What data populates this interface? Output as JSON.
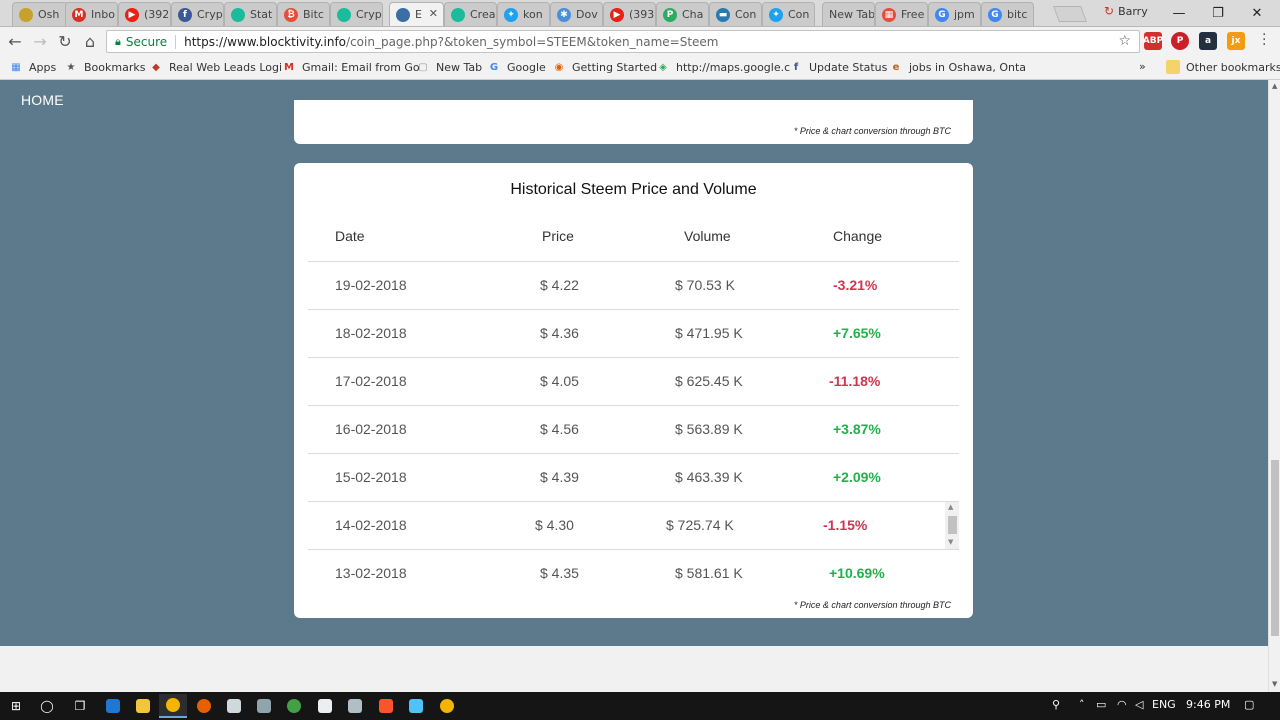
{
  "browser": {
    "tabs": [
      {
        "title": "Osh",
        "color": "#c6a12b",
        "glyph": ""
      },
      {
        "title": "Inbo",
        "color": "#d93025",
        "glyph": "M"
      },
      {
        "title": "(392",
        "color": "#e62117",
        "glyph": "▶"
      },
      {
        "title": "Cryp",
        "color": "#3b5998",
        "glyph": "f"
      },
      {
        "title": "Stat",
        "color": "#1abc9c",
        "glyph": ""
      },
      {
        "title": "Bitc",
        "color": "#e74c3c",
        "glyph": "₿"
      },
      {
        "title": "Cryp",
        "color": "#1abc9c",
        "glyph": ""
      },
      {
        "title": "E",
        "color": "#3a6ea5",
        "glyph": "",
        "active": true
      },
      {
        "title": "Crea",
        "color": "#1abc9c",
        "glyph": ""
      },
      {
        "title": "kon",
        "color": "#1da1f2",
        "glyph": "✦"
      },
      {
        "title": "Dov",
        "color": "#4a90d9",
        "glyph": "✱"
      },
      {
        "title": "(393",
        "color": "#e62117",
        "glyph": "▶"
      },
      {
        "title": "Cha",
        "color": "#27ae60",
        "glyph": "P"
      },
      {
        "title": "Con",
        "color": "#2a7ab0",
        "glyph": "▬"
      },
      {
        "title": "Con",
        "color": "#1da1f2",
        "glyph": "✦"
      },
      {
        "title": "New Tab",
        "color": "",
        "glyph": ""
      },
      {
        "title": "Free",
        "color": "#e84c3d",
        "glyph": "▦"
      },
      {
        "title": "jpm",
        "color": "#4285f4",
        "glyph": "G"
      },
      {
        "title": "bitc",
        "color": "#4285f4",
        "glyph": "G"
      }
    ],
    "profile_name": "Barry",
    "address": {
      "secure_label": "Secure",
      "url_host": "https://www.blocktivity.info",
      "url_path": "/coin_page.php?&token_symbol=STEEM&token_name=Steem"
    },
    "bookmarks": [
      {
        "label": "Apps",
        "icon": "apps-grid-icon"
      },
      {
        "label": "Bookmarks",
        "icon": "star-icon"
      },
      {
        "label": "Real Web Leads Logi",
        "icon": "web-leads-icon"
      },
      {
        "label": "Gmail: Email from Go",
        "icon": "gmail-icon"
      },
      {
        "label": "New Tab",
        "icon": "page-icon"
      },
      {
        "label": "Google",
        "icon": "google-icon"
      },
      {
        "label": "Getting Started",
        "icon": "firefox-icon"
      },
      {
        "label": "http://maps.google.c",
        "icon": "maps-icon"
      },
      {
        "label": "Update Status",
        "icon": "facebook-icon"
      },
      {
        "label": "jobs in Oshawa, Onta",
        "icon": "jobs-icon"
      }
    ],
    "bookmarks_overflow": "»",
    "other_bookmarks": "Other bookmarks"
  },
  "page": {
    "home_label": "HOME",
    "conversion_note": "* Price & chart conversion through BTC",
    "table": {
      "title": "Historical Steem Price and Volume",
      "headers": {
        "date": "Date",
        "price": "Price",
        "volume": "Volume",
        "change": "Change"
      },
      "rows": [
        {
          "date": "19-02-2018",
          "price": "$ 4.22",
          "volume": "$ 70.53 K",
          "change": "-3.21%",
          "direction": "down"
        },
        {
          "date": "18-02-2018",
          "price": "$ 4.36",
          "volume": "$ 471.95 K",
          "change": "+7.65%",
          "direction": "up"
        },
        {
          "date": "17-02-2018",
          "price": "$ 4.05",
          "volume": "$ 625.45 K",
          "change": "-11.18%",
          "direction": "down"
        },
        {
          "date": "16-02-2018",
          "price": "$ 4.56",
          "volume": "$ 563.89 K",
          "change": "+3.87%",
          "direction": "up"
        },
        {
          "date": "15-02-2018",
          "price": "$ 4.39",
          "volume": "$ 463.39 K",
          "change": "+2.09%",
          "direction": "up"
        },
        {
          "date": "14-02-2018",
          "price": "$ 4.30",
          "volume": "$ 725.74 K",
          "change": "-1.15%",
          "direction": "down"
        },
        {
          "date": "13-02-2018",
          "price": "$ 4.35",
          "volume": "$ 581.61 K",
          "change": "+10.69%",
          "direction": "up"
        }
      ]
    }
  },
  "taskbar": {
    "language": "ENG",
    "time": "9:46 PM"
  },
  "colors": {
    "page_background": "#5c7a8b",
    "negative_change": "#d0344f",
    "positive_change": "#21b14b",
    "secure_green": "#0b8043"
  }
}
